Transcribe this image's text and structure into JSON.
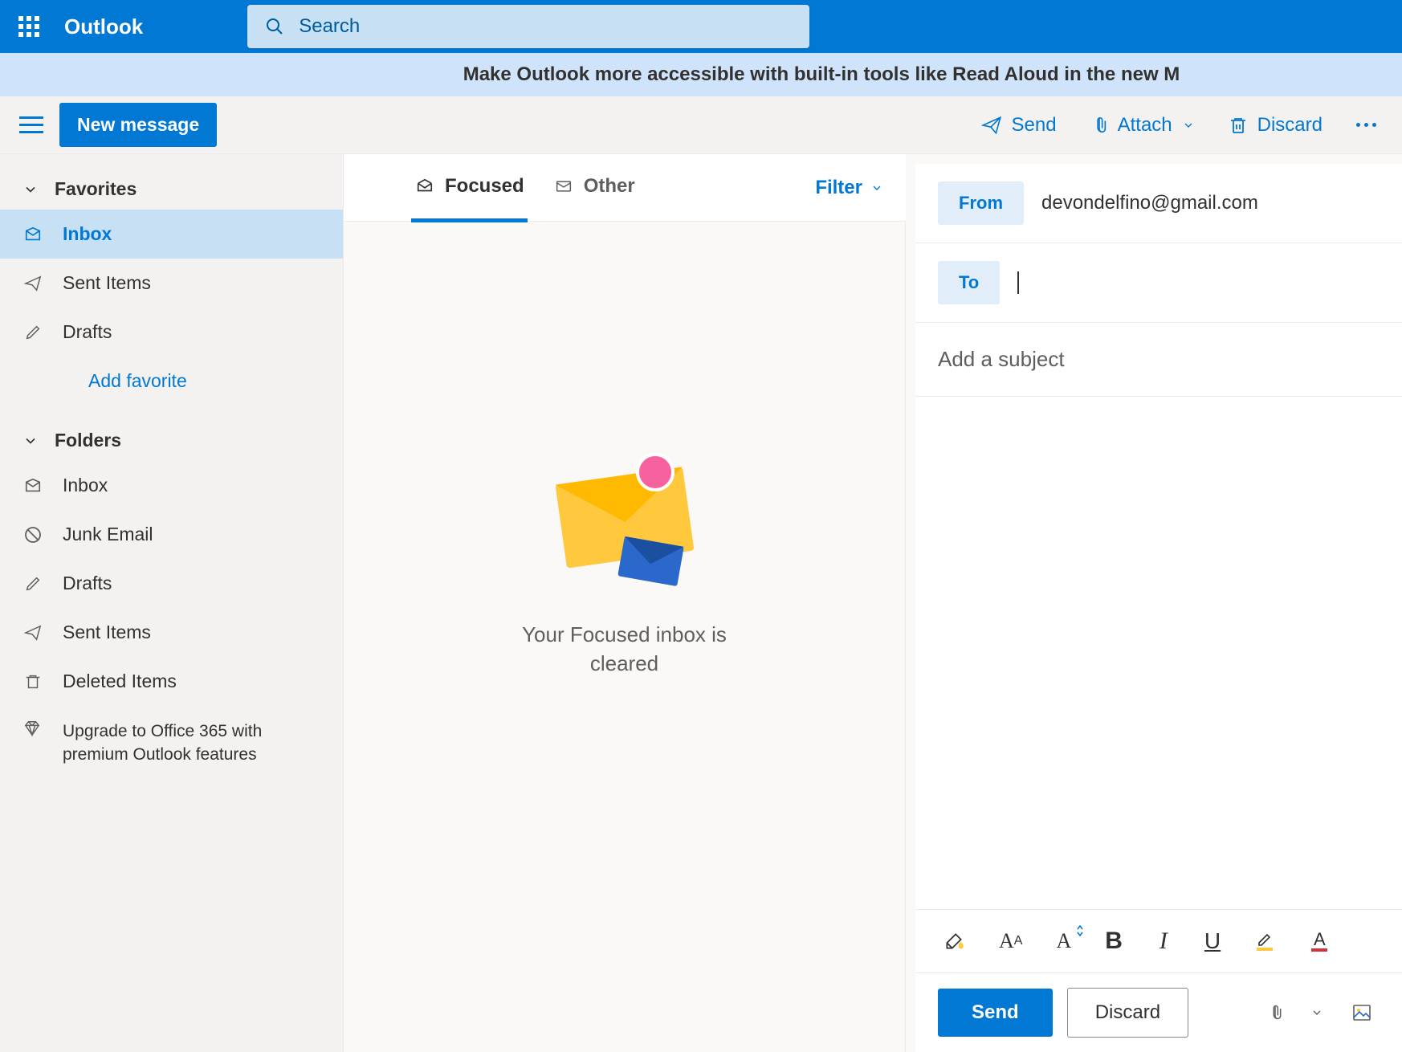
{
  "header": {
    "brand": "Outlook",
    "search_placeholder": "Search"
  },
  "banner": {
    "text": "Make Outlook more accessible with built-in tools like Read Aloud in the new M"
  },
  "commands": {
    "new_message": "New message",
    "send": "Send",
    "attach": "Attach",
    "discard": "Discard"
  },
  "sidebar": {
    "favorites_label": "Favorites",
    "folders_label": "Folders",
    "favorites": [
      {
        "label": "Inbox",
        "icon": "inbox",
        "selected": true
      },
      {
        "label": "Sent Items",
        "icon": "sent",
        "selected": false
      },
      {
        "label": "Drafts",
        "icon": "draft",
        "selected": false
      }
    ],
    "add_favorite": "Add favorite",
    "folders": [
      {
        "label": "Inbox",
        "icon": "inbox"
      },
      {
        "label": "Junk Email",
        "icon": "junk"
      },
      {
        "label": "Drafts",
        "icon": "draft"
      },
      {
        "label": "Sent Items",
        "icon": "sent"
      },
      {
        "label": "Deleted Items",
        "icon": "trash"
      }
    ],
    "upgrade": "Upgrade to Office 365 with premium Outlook features"
  },
  "list": {
    "tab_focused": "Focused",
    "tab_other": "Other",
    "filter": "Filter",
    "empty_message": "Your Focused inbox is cleared"
  },
  "compose": {
    "from_label": "From",
    "from_value": "devondelfino@gmail.com",
    "to_label": "To",
    "subject_placeholder": "Add a subject",
    "send_button": "Send",
    "discard_button": "Discard"
  }
}
